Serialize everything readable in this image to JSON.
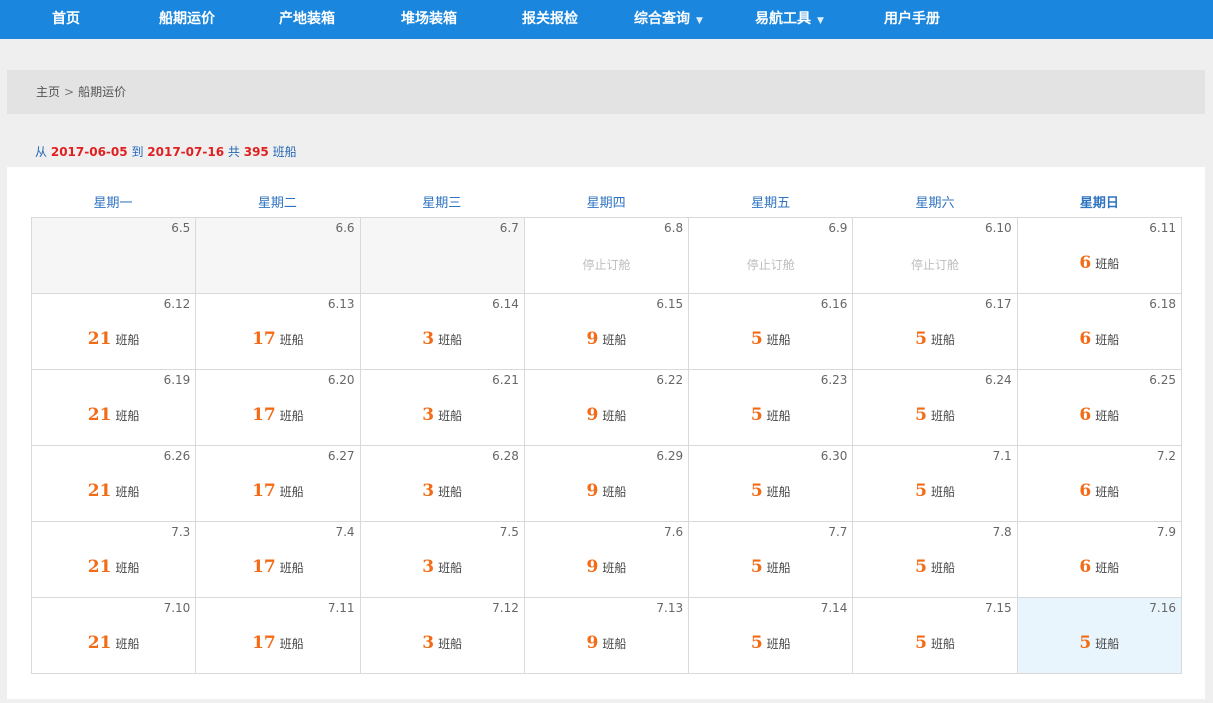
{
  "nav": {
    "items": [
      {
        "label": "首页"
      },
      {
        "label": "船期运价"
      },
      {
        "label": "产地装箱"
      },
      {
        "label": "堆场装箱"
      },
      {
        "label": "报关报检"
      },
      {
        "label": "综合查询",
        "dropdown": true
      },
      {
        "label": "易航工具",
        "dropdown": true
      },
      {
        "label": "用户手册"
      }
    ],
    "caret": "▼"
  },
  "breadcrumb": {
    "home": "主页",
    "separator": ">",
    "current": "船期运价"
  },
  "summary": {
    "from_label": "从",
    "start_date": "2017-06-05",
    "to_label": "到",
    "end_date": "2017-07-16",
    "total_label": "共",
    "total": "395",
    "unit": "班船"
  },
  "calendar": {
    "weekdays": [
      "星期一",
      "星期二",
      "星期三",
      "星期四",
      "星期五",
      "星期六",
      "星期日"
    ],
    "unit_label": "班船",
    "stopped_label": "停止订舱",
    "weeks": [
      [
        {
          "date": "6.5",
          "state": "past"
        },
        {
          "date": "6.6",
          "state": "past"
        },
        {
          "date": "6.7",
          "state": "past"
        },
        {
          "date": "6.8",
          "state": "stopped"
        },
        {
          "date": "6.9",
          "state": "stopped"
        },
        {
          "date": "6.10",
          "state": "stopped"
        },
        {
          "date": "6.11",
          "count": "6"
        }
      ],
      [
        {
          "date": "6.12",
          "count": "21"
        },
        {
          "date": "6.13",
          "count": "17"
        },
        {
          "date": "6.14",
          "count": "3"
        },
        {
          "date": "6.15",
          "count": "9"
        },
        {
          "date": "6.16",
          "count": "5"
        },
        {
          "date": "6.17",
          "count": "5"
        },
        {
          "date": "6.18",
          "count": "6"
        }
      ],
      [
        {
          "date": "6.19",
          "count": "21"
        },
        {
          "date": "6.20",
          "count": "17"
        },
        {
          "date": "6.21",
          "count": "3"
        },
        {
          "date": "6.22",
          "count": "9"
        },
        {
          "date": "6.23",
          "count": "5"
        },
        {
          "date": "6.24",
          "count": "5"
        },
        {
          "date": "6.25",
          "count": "6"
        }
      ],
      [
        {
          "date": "6.26",
          "count": "21"
        },
        {
          "date": "6.27",
          "count": "17"
        },
        {
          "date": "6.28",
          "count": "3"
        },
        {
          "date": "6.29",
          "count": "9"
        },
        {
          "date": "6.30",
          "count": "5"
        },
        {
          "date": "7.1",
          "count": "5"
        },
        {
          "date": "7.2",
          "count": "6"
        }
      ],
      [
        {
          "date": "7.3",
          "count": "21"
        },
        {
          "date": "7.4",
          "count": "17"
        },
        {
          "date": "7.5",
          "count": "3"
        },
        {
          "date": "7.6",
          "count": "9"
        },
        {
          "date": "7.7",
          "count": "5"
        },
        {
          "date": "7.8",
          "count": "5"
        },
        {
          "date": "7.9",
          "count": "6"
        }
      ],
      [
        {
          "date": "7.10",
          "count": "21"
        },
        {
          "date": "7.11",
          "count": "17"
        },
        {
          "date": "7.12",
          "count": "3"
        },
        {
          "date": "7.13",
          "count": "9"
        },
        {
          "date": "7.14",
          "count": "5"
        },
        {
          "date": "7.15",
          "count": "5"
        },
        {
          "date": "7.16",
          "count": "5",
          "state": "today"
        }
      ]
    ]
  },
  "colors": {
    "nav_bg": "#1a86de",
    "accent_blue": "#2f74c2",
    "count_orange": "#f36b16",
    "highlight_red": "#e02020",
    "today_bg": "#e8f5fc"
  }
}
